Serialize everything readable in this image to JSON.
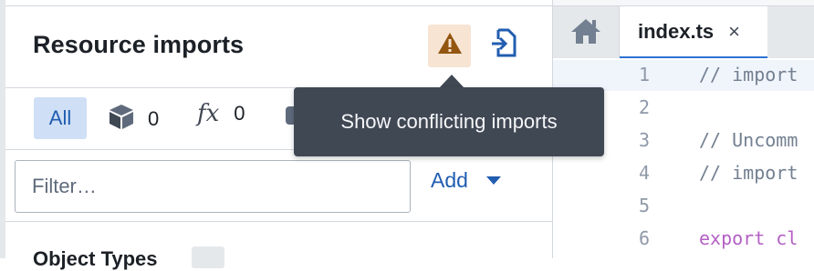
{
  "panel": {
    "title": "Resource imports",
    "warning_button_icon": "warning-icon",
    "import_button_icon": "import-resource-icon",
    "filters": {
      "all_label": "All",
      "object_icon": "cube-icon",
      "object_count": "0",
      "function_glyph": "fx",
      "function_count": "0"
    },
    "search": {
      "placeholder": "Filter…"
    },
    "add_label": "Add",
    "section_label": "Object Types"
  },
  "tooltip": {
    "text": "Show conflicting imports"
  },
  "editor": {
    "home_icon": "home-icon",
    "tab": {
      "name": "index.ts",
      "close": "×"
    },
    "lines": [
      {
        "num": "1",
        "text": "// import"
      },
      {
        "num": "2",
        "text": ""
      },
      {
        "num": "3",
        "text": "// Uncomm"
      },
      {
        "num": "4",
        "text": "// import"
      },
      {
        "num": "5",
        "text": ""
      },
      {
        "num": "6",
        "text": "export cl"
      }
    ]
  },
  "colors": {
    "accent": "#215db0",
    "warning_bg": "#f7e4d3",
    "warning_icon": "#935610",
    "tooltip_bg": "#404854",
    "active_tab_border": "#2d72d2",
    "keyword": "#b35fc4"
  }
}
